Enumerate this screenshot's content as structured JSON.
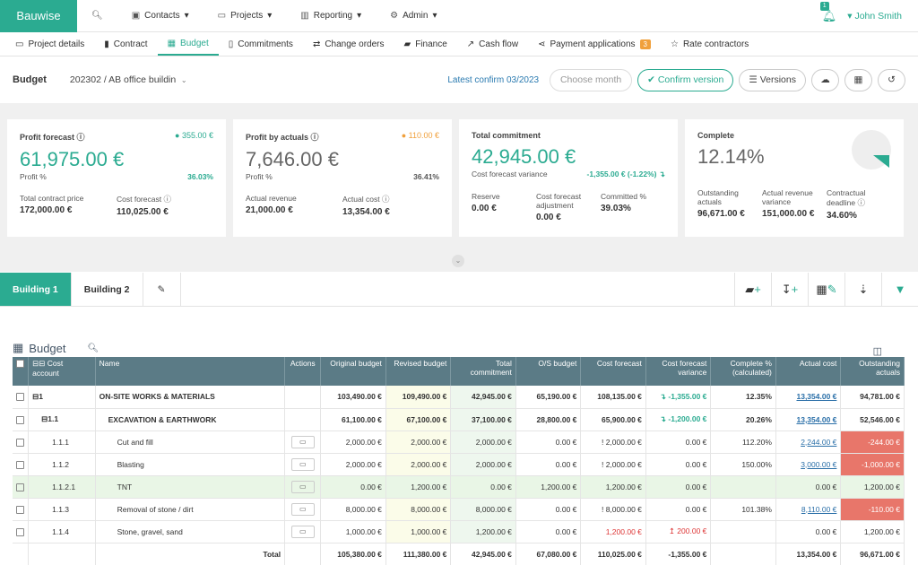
{
  "topbar": {
    "brand": "Bauwise",
    "nav": [
      {
        "label": "",
        "icon": "search-icon"
      },
      {
        "label": "Contacts",
        "icon": "contacts-icon"
      },
      {
        "label": "Projects",
        "icon": "folder-icon"
      },
      {
        "label": "Reporting",
        "icon": "chart-icon"
      },
      {
        "label": "Admin",
        "icon": "gear-icon"
      }
    ],
    "user": "John Smith",
    "bell_count": "1"
  },
  "tabs": [
    {
      "label": "Project details"
    },
    {
      "label": "Contract"
    },
    {
      "label": "Budget"
    },
    {
      "label": "Commitments"
    },
    {
      "label": "Change orders"
    },
    {
      "label": "Finance"
    },
    {
      "label": "Cash flow"
    },
    {
      "label": "Payment applications",
      "count": "3"
    },
    {
      "label": "Rate contractors"
    }
  ],
  "budget_header": {
    "label": "Budget",
    "project": "202302 / AB office building",
    "latest": "Latest confirm 03/2023",
    "month_placeholder": "Choose month",
    "confirm": "Confirm version",
    "versions": "Versions"
  },
  "cards": [
    {
      "title": "Profit forecast",
      "badge": "355.00 €",
      "badge_color": "#2bab91",
      "value": "61,975.00 €",
      "sub_label": "Profit %",
      "sub_value": "36.03%",
      "m1_label": "Total contract price",
      "m1_value": "172,000.00 €",
      "m2_label": "Cost forecast",
      "m2_value": "110,025.00 €"
    },
    {
      "title": "Profit by actuals",
      "badge": "110.00 €",
      "badge_color": "#f0a03c",
      "value": "7,646.00 €",
      "sub_label": "Profit %",
      "sub_value": "36.41%",
      "m1_label": "Actual revenue",
      "m1_value": "21,000.00 €",
      "m2_label": "Actual cost",
      "m2_value": "13,354.00 €"
    },
    {
      "title": "Total commitment",
      "value": "42,945.00 €",
      "sub_label": "Cost forecast variance",
      "sub_value": "-1,355.00 € (-1.22%) ↴",
      "m1_label": "Reserve",
      "m1_value": "0.00 €",
      "m2_label": "Cost forecast adjustment",
      "m2_value": "0.00 €",
      "m3_label": "Committed %",
      "m3_value": "39.03%"
    },
    {
      "title": "Complete",
      "value": "12.14%",
      "m1_label": "Outstanding actuals",
      "m1_value": "96,671.00 €",
      "m2_label": "Actual revenue variance",
      "m2_value": "151,000.00 €",
      "m3_label": "Contractual deadline",
      "m3_value": "34.60%"
    }
  ],
  "building_tabs": [
    "Building 1",
    "Building 2"
  ],
  "grid": {
    "title": "Budget",
    "headers": [
      "Cost account",
      "Name",
      "Actions",
      "Original budget",
      "Revised budget",
      "Total commitment",
      "O/S budget",
      "Cost forecast",
      "Cost forecast variance",
      "Complete % (calculated)",
      "Actual cost",
      "Outstanding actuals"
    ],
    "rows": [
      {
        "code": "1",
        "name": "ON-SITE WORKS & MATERIALS",
        "orig": "103,490.00 €",
        "rev": "109,490.00 €",
        "com": "42,945.00 €",
        "os": "65,190.00 €",
        "cf": "108,135.00 €",
        "var": "↴ -1,355.00 €",
        "comp": "12.35%",
        "act": "13,354.00 €",
        "out": "94,781.00 €"
      },
      {
        "code": "1.1",
        "name": "EXCAVATION & EARTHWORK",
        "orig": "61,100.00 €",
        "rev": "67,100.00 €",
        "com": "37,100.00 €",
        "os": "28,800.00 €",
        "cf": "65,900.00 €",
        "var": "↴ -1,200.00 €",
        "comp": "20.26%",
        "act": "13,354.00 €",
        "out": "52,546.00 €"
      },
      {
        "code": "1.1.1",
        "name": "Cut and fill",
        "orig": "2,000.00 €",
        "rev": "2,000.00 €",
        "com": "2,000.00 €",
        "os": "0.00 €",
        "cf": "! 2,000.00 €",
        "var": "0.00 €",
        "comp": "112.20%",
        "act": "2,244.00 €",
        "out": "-244.00 €"
      },
      {
        "code": "1.1.2",
        "name": "Blasting",
        "orig": "2,000.00 €",
        "rev": "2,000.00 €",
        "com": "2,000.00 €",
        "os": "0.00 €",
        "cf": "! 2,000.00 €",
        "var": "0.00 €",
        "comp": "150.00%",
        "act": "3,000.00 €",
        "out": "-1,000.00 €"
      },
      {
        "code": "1.1.2.1",
        "name": "TNT",
        "orig": "0.00 €",
        "rev": "1,200.00 €",
        "com": "0.00 €",
        "os": "1,200.00 €",
        "cf": "1,200.00 €",
        "var": "0.00 €",
        "comp": "",
        "act": "0.00 €",
        "out": "1,200.00 €"
      },
      {
        "code": "1.1.3",
        "name": "Removal of stone / dirt",
        "orig": "8,000.00 €",
        "rev": "8,000.00 €",
        "com": "8,000.00 €",
        "os": "0.00 €",
        "cf": "! 8,000.00 €",
        "var": "0.00 €",
        "comp": "101.38%",
        "act": "8,110.00 €",
        "out": "-110.00 €"
      },
      {
        "code": "1.1.4",
        "name": "Stone, gravel, sand",
        "orig": "1,000.00 €",
        "rev": "1,000.00 €",
        "com": "1,200.00 €",
        "os": "0.00 €",
        "cf": "1,200.00 €",
        "var": "↥ 200.00 €",
        "comp": "",
        "act": "0.00 €",
        "out": "1,200.00 €"
      }
    ],
    "total": {
      "label": "Total",
      "orig": "105,380.00 €",
      "rev": "111,380.00 €",
      "com": "42,945.00 €",
      "os": "67,080.00 €",
      "cf": "110,025.00 €",
      "var": "-1,355.00 €",
      "comp": "",
      "act": "13,354.00 €",
      "out": "96,671.00 €"
    }
  }
}
